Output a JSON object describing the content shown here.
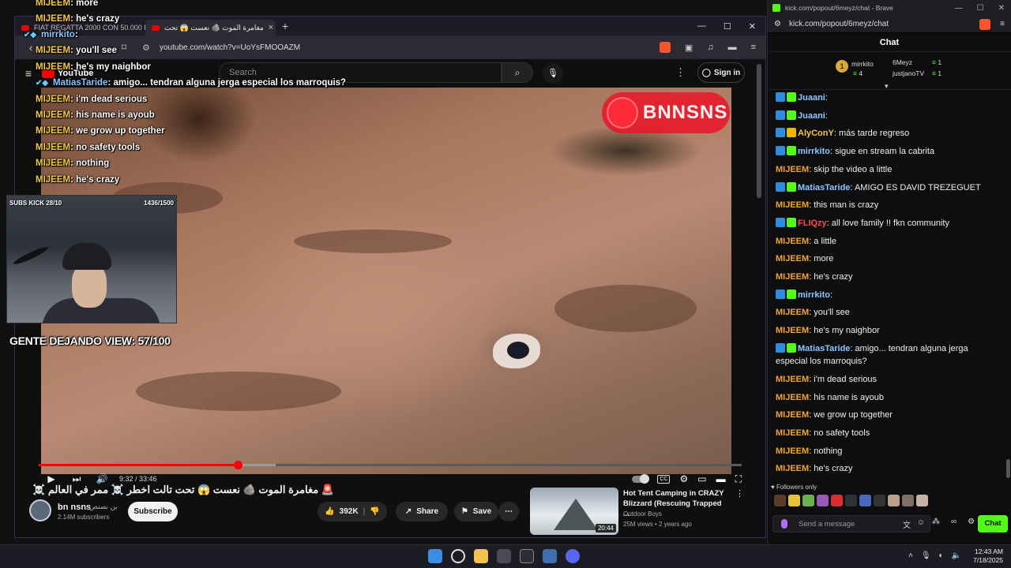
{
  "browser": {
    "tabs": [
      {
        "label": "FIAT REGATTA 2000 CON 50.000 KILO"
      },
      {
        "label": "مغامرة الموت 🪨 نعست 😱 تحت"
      }
    ],
    "tab_close": "×",
    "new_tab": "+",
    "window_buttons": [
      "—",
      "☐",
      "✕"
    ],
    "url": "youtube.com/watch?v=UoYsFMOOAZM"
  },
  "youtube": {
    "logo_text": "YouTube",
    "search_placeholder": "Search",
    "sign_in": "Sign in",
    "time_current": "9:32",
    "time_sep": " / ",
    "time_total": "33:46",
    "progress_fraction": 0.283,
    "video_title": "☠️ مغامرة الموت 🪨 نعست 😱 تحت تالت اخطر ☠️ ممر في العالم 🚨",
    "channel_name": "bn nsns",
    "channel_name_ar": "بن نصنص",
    "channel_subs": "2.14M subscribers",
    "subscribe": "Subscribe",
    "likes": "392K",
    "share": "Share",
    "save": "Save",
    "watermark": "BNNSNS",
    "recommended": {
      "title": "Hot Tent Camping in CRAZY Blizzard (Rescuing Trapped ...",
      "channel": "Outdoor Boys",
      "meta": "25M views • 2 years ago",
      "duration": "20:44"
    }
  },
  "overlay": {
    "chat": [
      {
        "user": "MIJEEM",
        "text": ": more"
      },
      {
        "user": "MIJEEM",
        "text": ": he's crazy"
      },
      {
        "user": "mirrkito",
        "text": ":",
        "badged": true
      },
      {
        "user": "MIJEEM",
        "text": ": you'll see"
      },
      {
        "user": "MIJEEM",
        "text": ": he's my naighbor"
      },
      {
        "user": "MatiasTaride",
        "text": ": amigo... tendran alguna jerga especial los marroquis?",
        "badged": true
      },
      {
        "user": "MIJEEM",
        "text": ": i'm dead serious"
      },
      {
        "user": "MIJEEM",
        "text": ": his name is ayoub"
      },
      {
        "user": "MIJEEM",
        "text": ": we grow up together"
      },
      {
        "user": "MIJEEM",
        "text": ": no safety tools"
      },
      {
        "user": "MIJEEM",
        "text": ": nothing"
      },
      {
        "user": "MIJEEM",
        "text": ": he's crazy"
      }
    ],
    "webcam_left_label": "SUBS KICK 28/10",
    "webcam_right_label": "1436/1500",
    "gente": "GENTE DEJANDO VIEW: 57/100"
  },
  "chatwin": {
    "title": "kick.com/popout/6meyz/chat - Brave",
    "url": "kick.com/popout/6meyz/chat",
    "header": "Chat",
    "gifters": {
      "rank": "1",
      "first": {
        "name": "mirrkito",
        "count": "4"
      },
      "second": {
        "name": "6Meyz",
        "count": "1"
      },
      "third": {
        "name": "justjanoTV",
        "count": "1"
      }
    },
    "messages": [
      {
        "user": "Juaani",
        "text": ":",
        "color": "#8ec6ff"
      },
      {
        "user": "Juaani",
        "text": ":",
        "color": "#8ec6ff"
      },
      {
        "user": "AlyConY",
        "text": ": más tarde regreso",
        "color": "#f2c84b"
      },
      {
        "user": "mirrkito",
        "text": ": sigue en stream la cabrita",
        "color": "#8ec6ff"
      },
      {
        "user": "MIJEEM",
        "text": ": skip the video a little",
        "color": "#f2a33a"
      },
      {
        "user": "MatiasTaride",
        "text": ": AMIGO ES DAVID TREZEGUET",
        "color": "#8ec6ff"
      },
      {
        "user": "MIJEEM",
        "text": ": this man is crazy",
        "color": "#f2a33a"
      },
      {
        "user": "FLIQzy",
        "text": ": all love family !!  fkn community",
        "color": "#ff4a4a"
      },
      {
        "user": "MIJEEM",
        "text": ": a little",
        "color": "#f2a33a"
      },
      {
        "user": "MIJEEM",
        "text": ": more",
        "color": "#f2a33a"
      },
      {
        "user": "MIJEEM",
        "text": ": he's crazy",
        "color": "#f2a33a"
      },
      {
        "user": "mirrkito",
        "text": ":",
        "color": "#8ec6ff"
      },
      {
        "user": "MIJEEM",
        "text": ": you'll see",
        "color": "#f2a33a"
      },
      {
        "user": "MIJEEM",
        "text": ": he's my naighbor",
        "color": "#f2a33a"
      },
      {
        "user": "MatiasTaride",
        "text": ": amigo... tendran alguna jerga especial los marroquis?",
        "color": "#8ec6ff"
      },
      {
        "user": "MIJEEM",
        "text": ": i'm dead serious",
        "color": "#f2a33a"
      },
      {
        "user": "MIJEEM",
        "text": ": his name is ayoub",
        "color": "#f2a33a"
      },
      {
        "user": "MIJEEM",
        "text": ": we grow up together",
        "color": "#f2a33a"
      },
      {
        "user": "MIJEEM",
        "text": ": no safety tools",
        "color": "#f2a33a"
      },
      {
        "user": "MIJEEM",
        "text": ": nothing",
        "color": "#f2a33a"
      },
      {
        "user": "MIJEEM",
        "text": ": he's crazy",
        "color": "#f2a33a"
      }
    ],
    "followers_only": "♥ Followers only",
    "input_placeholder": "Send a message",
    "send": "Chat"
  },
  "taskbar": {
    "time": "12:43 AM",
    "date": "7/18/2025"
  },
  "colors": {
    "kick_green": "#53fc18",
    "yt_red": "#ff0000",
    "accent_purple": "#3a2b56"
  }
}
